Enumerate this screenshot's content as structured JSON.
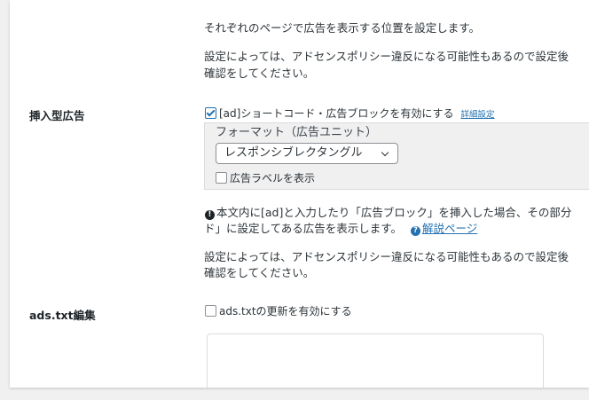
{
  "intro": {
    "line1": "それぞれのページで広告を表示する位置を設定します。",
    "warn1_line1": "設定によっては、アドセンスポリシー違反になる可能性もあるので設定後",
    "warn1_line2": "確認をしてください。"
  },
  "inline_ad": {
    "label": "挿入型広告",
    "enable_checkbox_label": "[ad]ショートコード・広告ブロックを有効にする",
    "enable_checked": true,
    "detail_link": "詳細設定",
    "format_label": "フォーマット（広告ユニット）",
    "format_select_value": "レスポンシブレクタングル",
    "show_label_checkbox_label": "広告ラベルを表示",
    "show_label_checked": false,
    "note_line1": "本文内に[ad]と入力したり「広告ブロック」を挿入した場合、その部分",
    "note_line2": "ド」に設定してある広告を表示します。",
    "help_link": "解説ページ",
    "warn_line1": "設定によっては、アドセンスポリシー違反になる可能性もあるので設定後",
    "warn_line2": "確認をしてください。"
  },
  "ads_txt": {
    "label": "ads.txt編集",
    "enable_checkbox_label": "ads.txtの更新を有効にする",
    "enable_checked": false,
    "textarea_value": ""
  }
}
